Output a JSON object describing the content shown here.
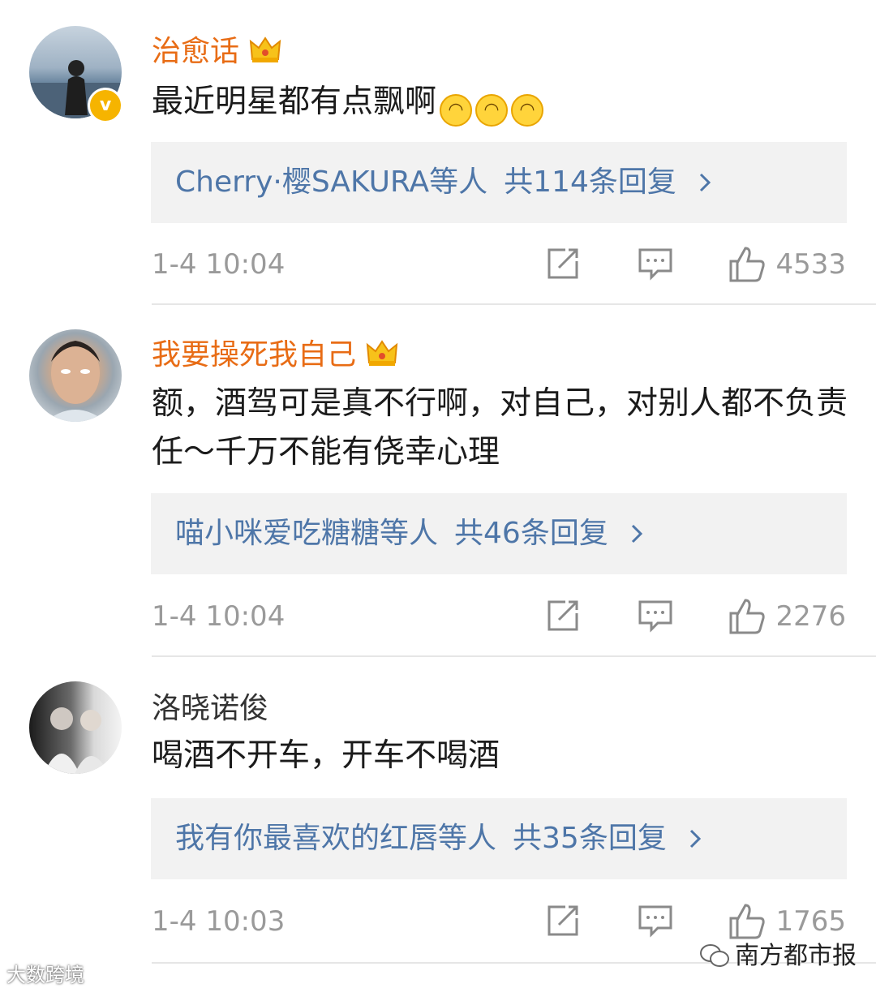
{
  "comments": [
    {
      "username": "治愈话",
      "text": "最近明星都有点飘啊",
      "emoji_count": 3,
      "reply_names": "Cherry·樱SAKURA等人",
      "reply_count": "共114条回复",
      "time": "1-4 10:04",
      "likes": "4533",
      "verified": true
    },
    {
      "username": "我要操死我自己",
      "text": "额，酒驾可是真不行啊，对自己，对别人都不负责任～千万不能有侥幸心理",
      "reply_names": "喵小咪爱吃糖糖等人",
      "reply_count": "共46条回复",
      "time": "1-4 10:04",
      "likes": "2276"
    },
    {
      "username": "洛晓诺俊",
      "text": "喝酒不开车，开车不喝酒",
      "reply_names": "我有你最喜欢的红唇等人",
      "reply_count": "共35条回复",
      "time": "1-4 10:03",
      "likes": "1765"
    }
  ],
  "watermark_left": "大数跨境",
  "watermark_right": "南方都市报",
  "colors": {
    "username_vip": "#e86c15",
    "reply_link": "#4e76a8",
    "meta_gray": "#9a9a9a"
  },
  "icons": [
    "crown-icon",
    "verified-icon",
    "share-icon",
    "comment-icon",
    "like-icon",
    "chevron-right-icon",
    "wechat-icon"
  ]
}
